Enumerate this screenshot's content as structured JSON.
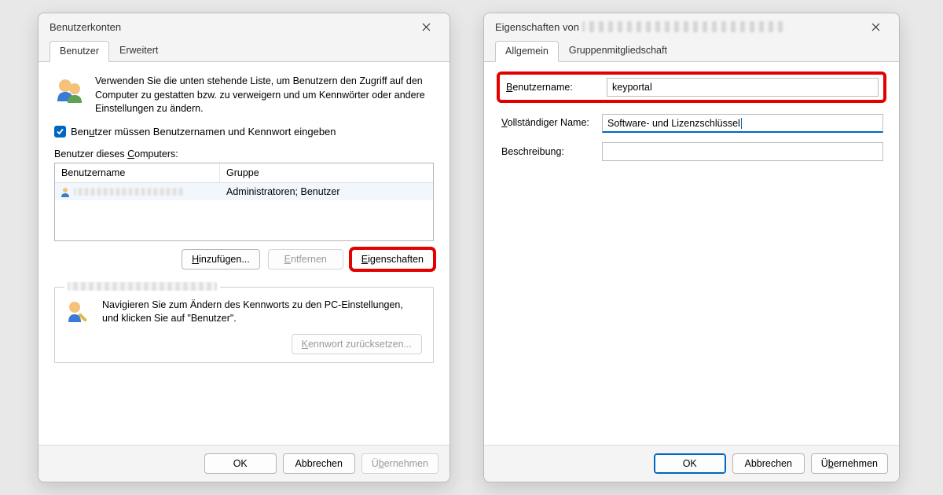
{
  "left": {
    "title": "Benutzerkonten",
    "tabs": {
      "users": "Benutzer",
      "advanced": "Erweitert"
    },
    "intro": "Verwenden Sie die unten stehende Liste, um Benutzern den Zugriff auf den Computer zu gestatten bzw. zu verweigern und um Kennwörter oder andere Einstellungen zu ändern.",
    "checkbox_label_pre": "Ben",
    "checkbox_label_underline": "u",
    "checkbox_label_post": "tzer müssen Benutzernamen und Kennwort eingeben",
    "list_label_pre": "Benutzer dieses ",
    "list_label_underline": "C",
    "list_label_post": "omputers:",
    "headers": {
      "user": "Benutzername",
      "group": "Gruppe"
    },
    "row_group": "Administratoren; Benutzer",
    "buttons": {
      "add_pre": "",
      "add_u": "H",
      "add_post": "inzufügen...",
      "remove_pre": "",
      "remove_u": "E",
      "remove_post": "ntfernen",
      "props_pre": "",
      "props_u": "E",
      "props_post": "igenschaften"
    },
    "pw_msg": "Navigieren Sie zum Ändern des Kennworts zu den PC-Einstellungen, und klicken Sie auf \"Benutzer\".",
    "reset_pre": "",
    "reset_u": "K",
    "reset_post": "ennwort zurücksetzen...",
    "footer": {
      "ok": "OK",
      "cancel": "Abbrechen",
      "apply_pre": "Ü",
      "apply_u": "b",
      "apply_post": "ernehmen"
    }
  },
  "right": {
    "title_prefix": "Eigenschaften von ",
    "tabs": {
      "general": "Allgemein",
      "membership": "Gruppenmitgliedschaft"
    },
    "username_label_pre": "",
    "username_label_u": "B",
    "username_label_post": "enutzername:",
    "username_value": "keyportal",
    "fullname_label_pre": "",
    "fullname_label_u": "V",
    "fullname_label_post": "ollständiger Name:",
    "fullname_value": "Software- und Lizenzschlüssel",
    "desc_label": "Beschreibung:",
    "desc_value": "",
    "footer": {
      "ok": "OK",
      "cancel": "Abbrechen",
      "apply_pre": "Ü",
      "apply_u": "b",
      "apply_post": "ernehmen"
    }
  }
}
